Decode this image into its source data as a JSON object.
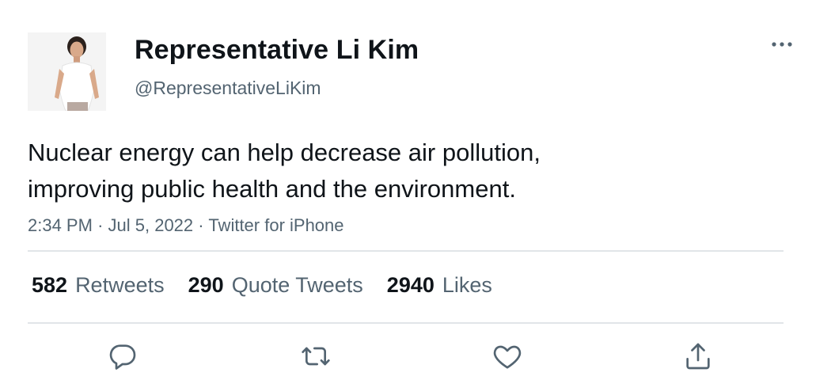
{
  "author": {
    "name": "Representative Li Kim",
    "handle": "@RepresentativeLiKim"
  },
  "tweet": {
    "lines": [
      "Nuclear energy can help decrease air pollution,",
      "improving public health and the environment."
    ],
    "time": "2:34 PM",
    "separator": "·",
    "date": "Jul 5, 2022",
    "source": "Twitter for iPhone"
  },
  "stats": {
    "retweets": {
      "count": "582",
      "label": "Retweets"
    },
    "quotes": {
      "count": "290",
      "label": "Quote Tweets"
    },
    "likes": {
      "count": "2940",
      "label": "Likes"
    }
  },
  "icons": {
    "more": "more-horizontal-icon",
    "reply": "reply-icon",
    "retweet": "retweet-icon",
    "like": "heart-icon",
    "share": "share-icon"
  },
  "colors": {
    "text_primary": "#0f1419",
    "text_secondary": "#536471",
    "divider": "#e1e5e8",
    "icon": "#536471"
  }
}
